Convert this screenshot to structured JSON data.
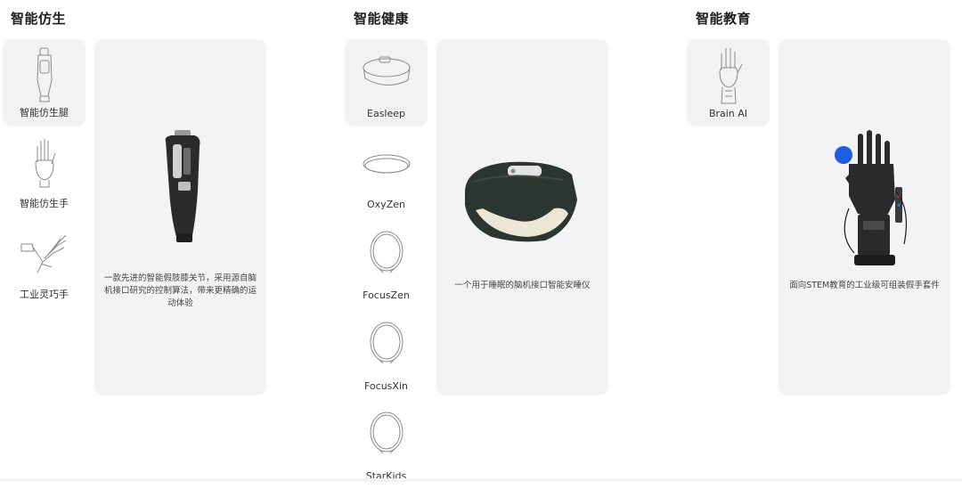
{
  "columns": [
    {
      "title": "智能仿生",
      "items": [
        {
          "label": "智能仿生腿",
          "icon": "prosthetic-leg-icon",
          "active": true
        },
        {
          "label": "智能仿生手",
          "icon": "prosthetic-hand-icon",
          "active": false
        },
        {
          "label": "工业灵巧手",
          "icon": "dexterous-hand-icon",
          "active": false
        }
      ],
      "panel": {
        "description": "一款先进的智能假肢膝关节，采用源自脑机接口研究的控制算法，带来更精确的运动体验"
      }
    },
    {
      "title": "智能健康",
      "items": [
        {
          "label": "Easleep",
          "icon": "sleep-headband-icon",
          "active": true
        },
        {
          "label": "OxyZen",
          "icon": "headband-icon",
          "active": false
        },
        {
          "label": "FocusZen",
          "icon": "neck-ring-icon",
          "active": false
        },
        {
          "label": "FocusXin",
          "icon": "neck-ring-icon",
          "active": false
        },
        {
          "label": "StarKids",
          "icon": "neck-ring-icon",
          "active": false
        }
      ],
      "panel": {
        "description": "一个用于睡眠的脑机接口智能安睡仪"
      }
    },
    {
      "title": "智能教育",
      "items": [
        {
          "label": "Brain AI",
          "icon": "robotic-hand-icon",
          "active": true
        }
      ],
      "panel": {
        "description": "面向STEM教育的工业级可组装假手套件"
      }
    }
  ],
  "colors": {
    "panel_bg": "#f3f3f5",
    "active_thumb_bg": "#f2f2f4",
    "accent_blue": "#1f5ee0"
  }
}
